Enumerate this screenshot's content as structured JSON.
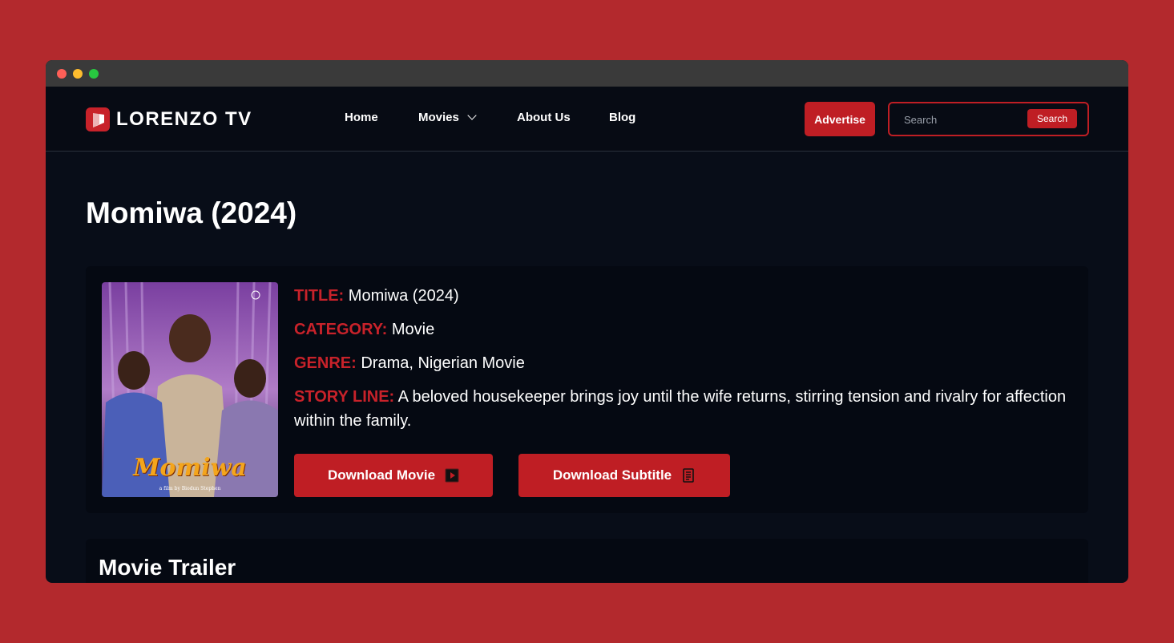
{
  "brand": {
    "name": "LORENZO TV"
  },
  "nav": {
    "items": [
      {
        "label": "Home"
      },
      {
        "label": "Movies"
      },
      {
        "label": "About Us"
      },
      {
        "label": "Blog"
      }
    ],
    "advertise_label": "Advertise",
    "search": {
      "placeholder": "Search",
      "button_label": "Search"
    }
  },
  "page": {
    "title": "Momiwa (2024)"
  },
  "movie": {
    "poster": {
      "title_text": "Momiwa",
      "credit_text": "a film by Biodun Stephen"
    },
    "fields": [
      {
        "label": "TITLE:",
        "value": "Momiwa (2024)"
      },
      {
        "label": "CATEGORY:",
        "value": "Movie"
      },
      {
        "label": "GENRE:",
        "value": "Drama, Nigerian Movie"
      },
      {
        "label": "STORY LINE:",
        "value": "A beloved housekeeper brings joy until the wife returns, stirring tension and rivalry for affection within the family."
      }
    ],
    "download_movie_label": "Download Movie",
    "download_subtitle_label": "Download Subtitle"
  },
  "trailer": {
    "heading": "Movie Trailer"
  },
  "colors": {
    "accent": "#bf1e24",
    "label_red": "#c8222a",
    "background": "#080d18",
    "frame": "#b3292d"
  },
  "icons": {
    "logo": "logo-icon",
    "movies_dropdown": "chevron-down-icon",
    "download_movie": "film-icon",
    "download_subtitle": "document-icon"
  }
}
